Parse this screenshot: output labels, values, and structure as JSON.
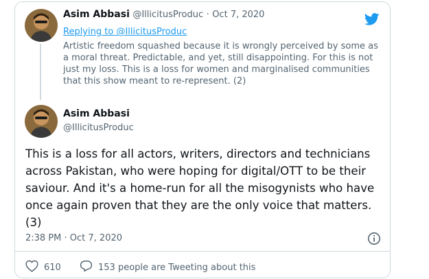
{
  "quoted_tweet": {
    "author_name": "Asim Abbasi",
    "handle": "@IllicitusProduc",
    "separator": "·",
    "date": "Oct 7, 2020",
    "replying_prefix": "Replying to ",
    "replying_handle": "@IllicitusProduc",
    "text": "Artistic freedom squashed because it is wrongly perceived by some as a moral threat. Predictable, and yet, still disappointing. For this is not just my loss. This is a loss for women and marginalised communities that this show meant to re-represent. (2)"
  },
  "main_tweet": {
    "author_name": "Asim Abbasi",
    "handle": "@IllicitusProduc",
    "text": "This is a loss for all actors, writers, directors and technicians across Pakistan, who were hoping for digital/OTT to be their saviour. And it's a home-run for all the misogynists who have once again proven that they are the only voice that matters. (3)",
    "timestamp": "2:38 PM · Oct 7, 2020"
  },
  "actions": {
    "likes": "610",
    "tweeting_text": "153 people are Tweeting about this"
  },
  "icons": {
    "brand": "twitter-bird-icon",
    "info": "info-icon",
    "like": "heart-icon",
    "reply": "speech-bubble-icon"
  },
  "colors": {
    "brand_blue": "#1d9bf0",
    "muted": "#536471",
    "border": "#cfd9de",
    "text": "#0f1419"
  }
}
